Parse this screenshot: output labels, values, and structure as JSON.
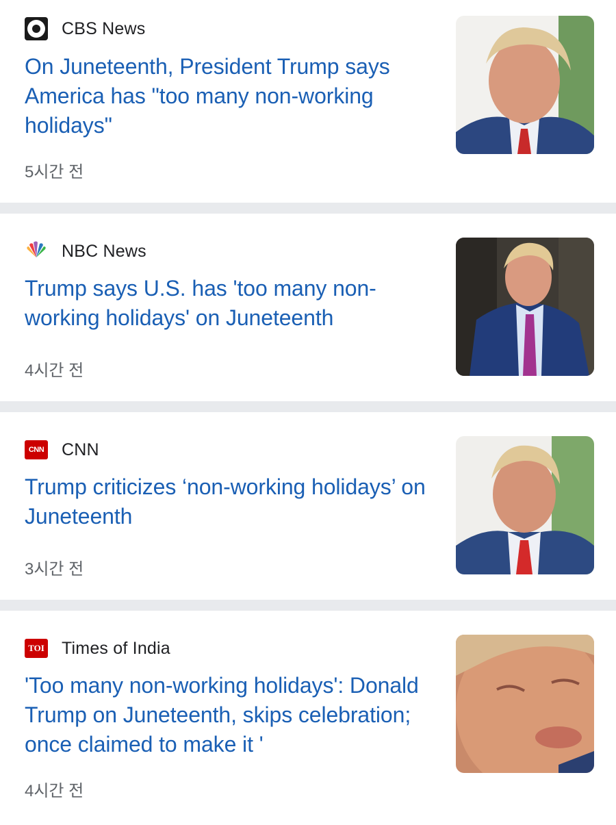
{
  "articles": [
    {
      "source": "CBS News",
      "logo_icon": "cbs-eye-logo",
      "headline": "On Juneteenth, President Trump says America has \"too many non-working holidays\"",
      "time": "5시간 전",
      "thumbnail_icon": "news-photo-thumbnail"
    },
    {
      "source": "NBC News",
      "logo_icon": "nbc-peacock-logo",
      "headline": "Trump says U.S. has 'too many non-working holidays' on Juneteenth",
      "time": "4시간 전",
      "thumbnail_icon": "news-photo-thumbnail"
    },
    {
      "source": "CNN",
      "logo_icon": "cnn-logo",
      "logo_text": "CNN",
      "headline": "Trump criticizes ‘non-working holidays’ on Juneteenth",
      "time": "3시간 전",
      "thumbnail_icon": "news-photo-thumbnail"
    },
    {
      "source": "Times of India",
      "logo_icon": "toi-logo",
      "logo_text": "TOI",
      "headline": "'Too many non-working holidays': Donald Trump on Juneteenth, skips celebration; once claimed to make it '",
      "time": "4시간 전",
      "thumbnail_icon": "news-photo-thumbnail"
    }
  ],
  "colors": {
    "headline": "#1a5fb4",
    "separator": "#e8eaed",
    "time": "#5f6368",
    "brand_red": "#cc0000"
  }
}
